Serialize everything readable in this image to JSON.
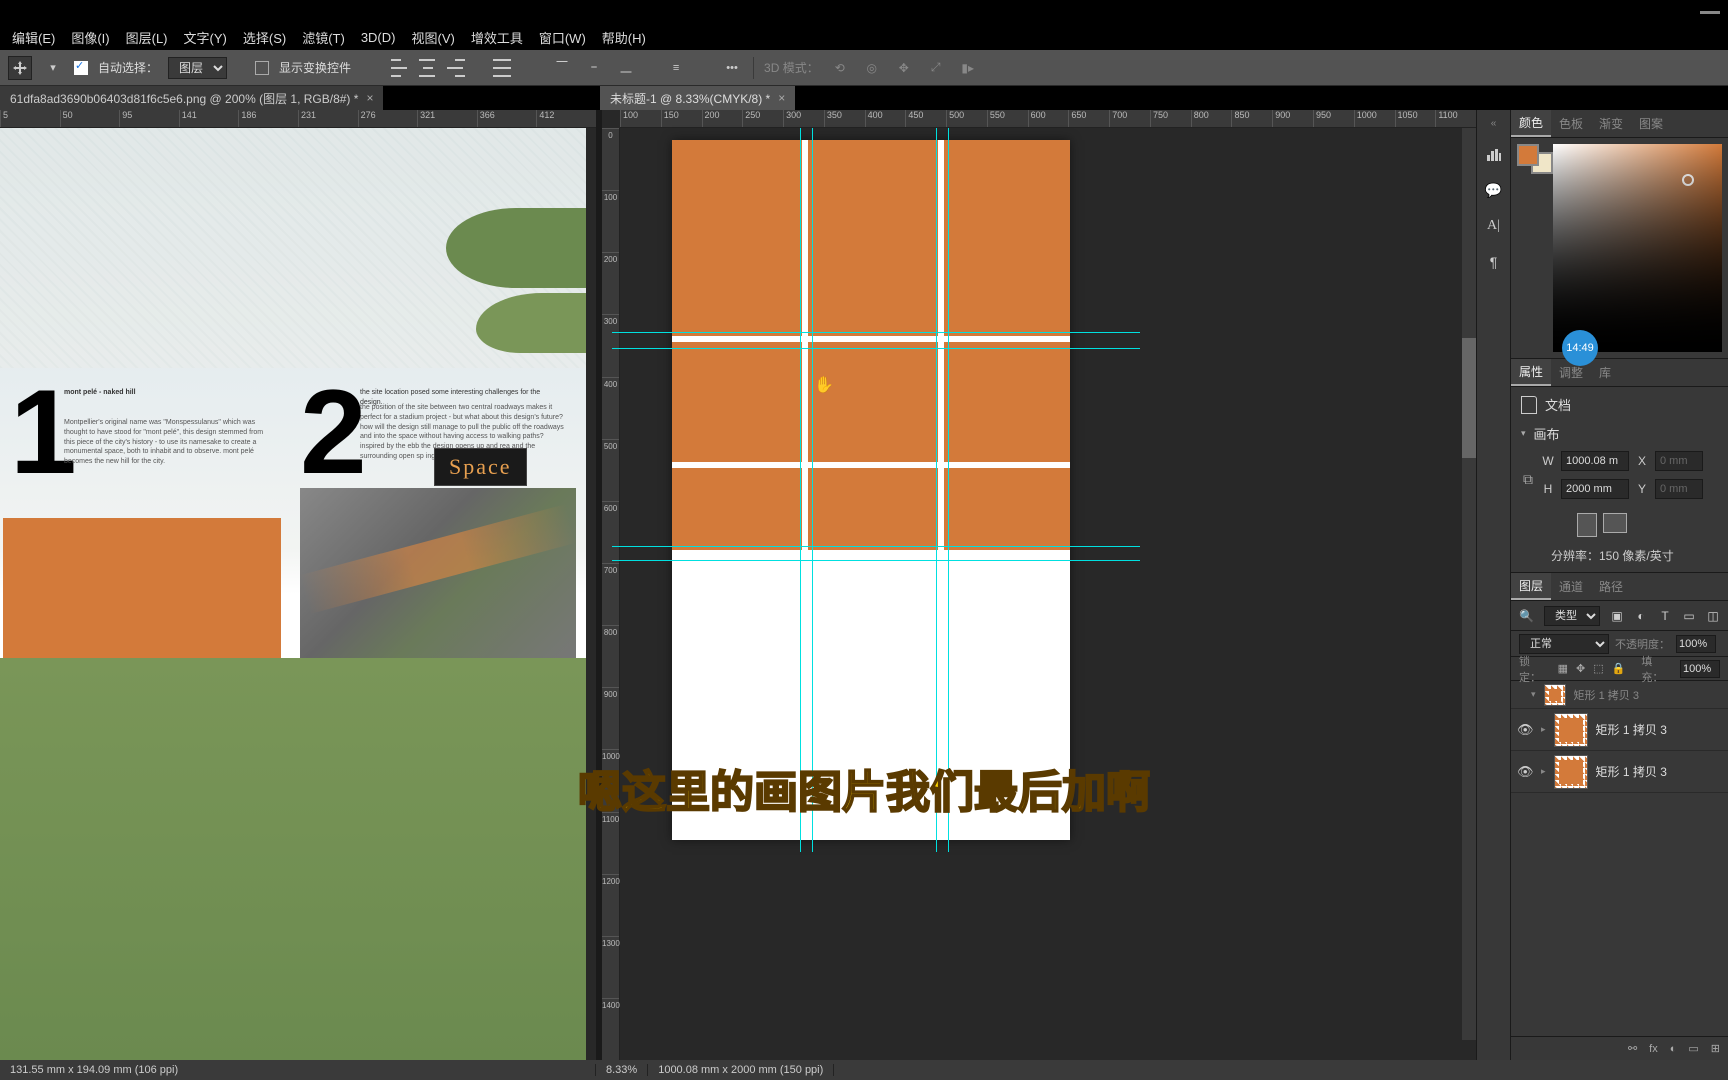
{
  "menus": {
    "edit": "编辑(E)",
    "image": "图像(I)",
    "layer": "图层(L)",
    "type": "文字(Y)",
    "select": "选择(S)",
    "filter": "滤镜(T)",
    "threed": "3D(D)",
    "view": "视图(V)",
    "plugins": "增效工具",
    "window": "窗口(W)",
    "help": "帮助(H)"
  },
  "options": {
    "autoselect_label": "自动选择：",
    "autoselect_value": "图层",
    "showtransform_label": "显示变换控件",
    "mode3d_label": "3D 模式："
  },
  "tabs": {
    "left": "61dfa8ad3690b06403d81f6c5e6.png @ 200% (图层 1, RGB/8#) *",
    "right": "未标题-1 @ 8.33%(CMYK/8) *"
  },
  "ruler_left": [
    "5",
    "50",
    "95",
    "141",
    "186",
    "231",
    "276",
    "321",
    "366",
    "412"
  ],
  "ruler_right_h": [
    "100",
    "150",
    "200",
    "250",
    "300",
    "350",
    "400",
    "450",
    "500",
    "550",
    "600",
    "650",
    "700",
    "750",
    "800",
    "850",
    "900",
    "950",
    "1000",
    "1050",
    "1100"
  ],
  "ruler_right_v": [
    "0",
    "100",
    "200",
    "300",
    "400",
    "500",
    "600",
    "700",
    "800",
    "900",
    "1000",
    "1100",
    "1200",
    "1300",
    "1400"
  ],
  "leftdoc": {
    "head1": "mont pelé - naked hill",
    "text1": "Montpellier's original name was \"Monspessulanus\" which was thought to have stood for \"mont pelé\", this design stemmed from this piece of the city's history - to use its namesake to create a monumental space, both to inhabit and to observe.\n\nmont pelé becomes the new hill for the city.",
    "head2": "the site location posed some interesting challenges for the design.",
    "text2": "the position of the site between two central roadways makes it perfect for a stadium project - but what about this design's future? how will the design still manage to pull the public off the roadways and into the space without having access to walking paths?\n\ninspired by the ebb                                        the design opens up and rea                                 and the surrounding open sp                         ing gesture.",
    "spacelabel": "Space"
  },
  "timestamp": "14:49",
  "panels": {
    "color_tabs": {
      "color": "颜色",
      "swatches": "色板",
      "gradient": "渐变",
      "pattern": "图案"
    },
    "props_tabs": {
      "properties": "属性",
      "adjust": "调整",
      "library": "库"
    },
    "props": {
      "doc_label": "文档",
      "canvas_label": "画布",
      "w_label": "W",
      "w_value": "1000.08 m",
      "h_label": "H",
      "h_value": "2000 mm",
      "x_label": "X",
      "x_value": "0 mm",
      "y_label": "Y",
      "y_value": "0 mm",
      "resolution": "分辨率：150 像素/英寸"
    },
    "layers_tabs": {
      "layers": "图层",
      "channels": "通道",
      "paths": "路径"
    },
    "layers": {
      "kind": "类型",
      "blend": "正常",
      "opacity_label": "不透明度：",
      "opacity_value": "100%",
      "lock_label": "锁定：",
      "fill_label": "填充：",
      "fill_value": "100%",
      "rows": [
        {
          "name": "矩形 1 拷贝 3"
        },
        {
          "name": "矩形 1 拷贝 3"
        }
      ]
    }
  },
  "status": {
    "left": "131.55 mm x 194.09 mm (106 ppi)",
    "zoom": "8.33%",
    "right": "1000.08 mm x 2000 mm (150 ppi)"
  },
  "subtitle": "嗯这里的画图片我们最后加啊"
}
